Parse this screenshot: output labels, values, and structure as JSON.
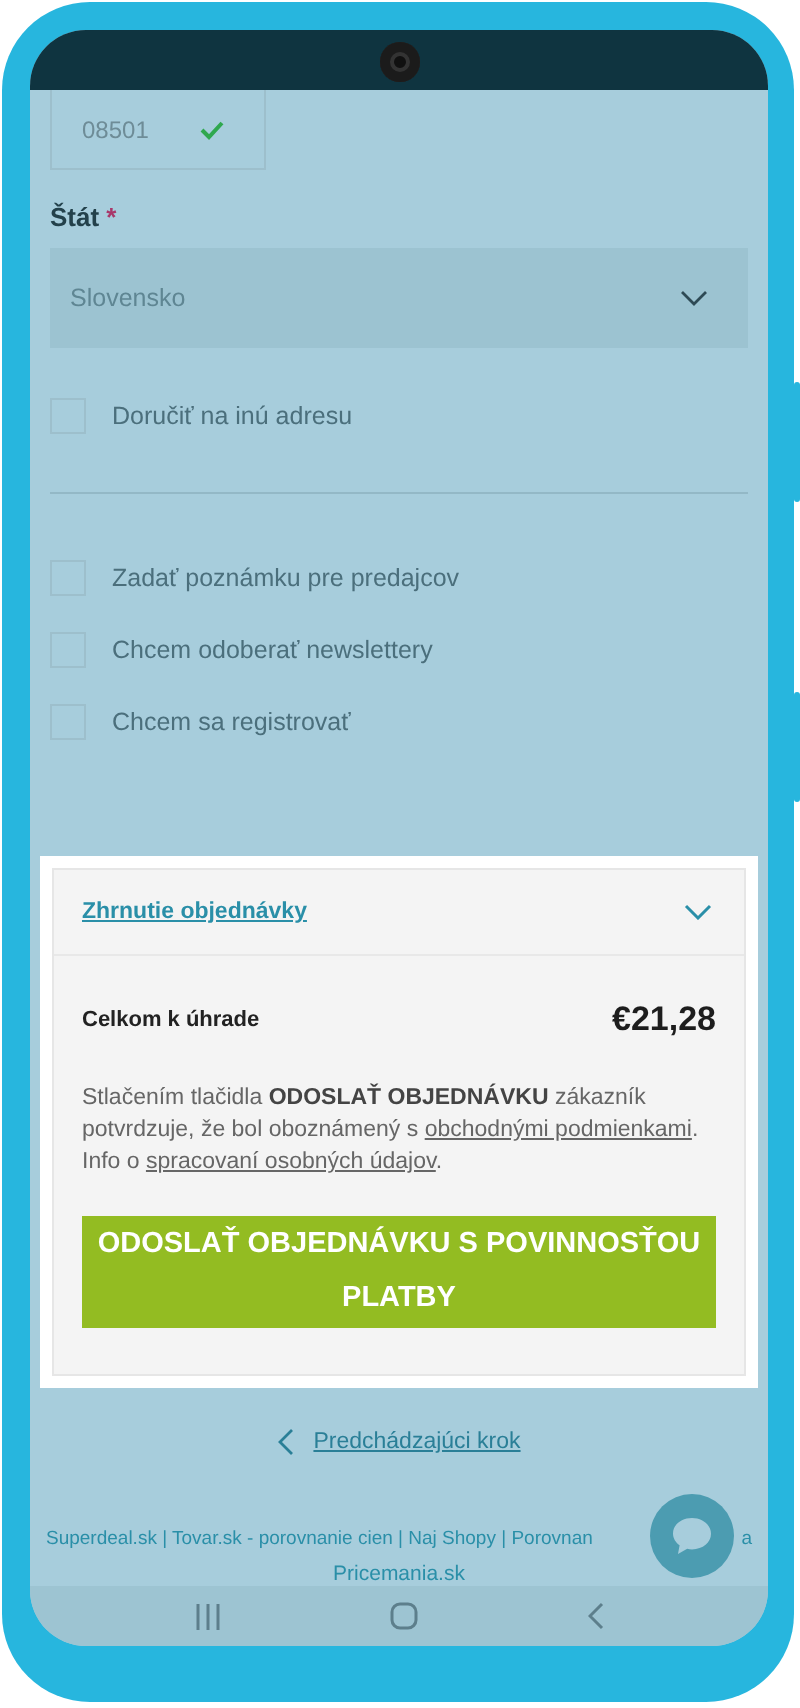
{
  "zip_field": {
    "value": "08501",
    "valid": true
  },
  "country": {
    "label": "Štát",
    "required_mark": "*",
    "value": "Slovensko"
  },
  "ship_other": {
    "label": "Doručiť na inú adresu",
    "checked": false
  },
  "options": [
    {
      "label": "Zadať poznámku pre predajcov",
      "checked": false
    },
    {
      "label": "Chcem odoberať newslettery",
      "checked": false
    },
    {
      "label": "Chcem sa registrovať",
      "checked": false
    }
  ],
  "summary": {
    "title": "Zhrnutie objednávky",
    "expanded": false,
    "total_label": "Celkom k úhrade",
    "total_value": "€21,28",
    "terms_before": "Stlačením tlačidla **ODOSLAŤ OBJEDNÁVKU** zákazník potvrdzuje, že bol oboznámený s",
    "terms_link_1": "obchodnými podmienkami",
    "terms_middle": ". Info o",
    "terms_link_2": "spracovaní osobných údajov",
    "terms_after": ".",
    "submit": "ODOSLAŤ OBJEDNÁVKU S POVINNOSŤOU PLATBY"
  },
  "prev_step": "Predchádzajúci krok",
  "footer": {
    "line_1": "Superdeal.sk | Tovar.sk - porovnanie cien | Naj Shopy | Porovnan",
    "line_1_end": "a",
    "line_2": "Pricemania.sk"
  }
}
